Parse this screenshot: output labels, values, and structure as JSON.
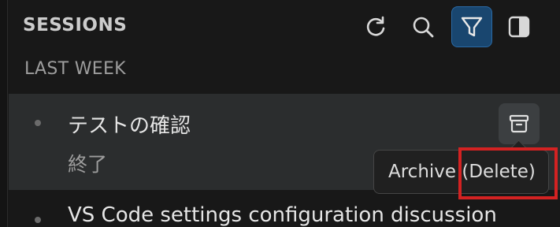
{
  "header": {
    "title": "SESSIONS",
    "toolbar": [
      {
        "name": "refresh-icon",
        "active": false
      },
      {
        "name": "search-icon",
        "active": false
      },
      {
        "name": "filter-icon",
        "active": true
      },
      {
        "name": "toggle-sidebar-icon",
        "active": false
      }
    ]
  },
  "section": {
    "label": "LAST WEEK"
  },
  "sessions": [
    {
      "title": "テストの確認",
      "status": "終了",
      "actions": {
        "archive_icon": "archive-icon"
      }
    },
    {
      "title": "VS Code settings configuration discussion"
    }
  ],
  "tooltip": {
    "text": "Archive (Delete)"
  },
  "colors": {
    "background": "#181818",
    "selected_item": "#2b2d2e",
    "active_toolbar": "#19466f",
    "highlight": "#d32222"
  }
}
